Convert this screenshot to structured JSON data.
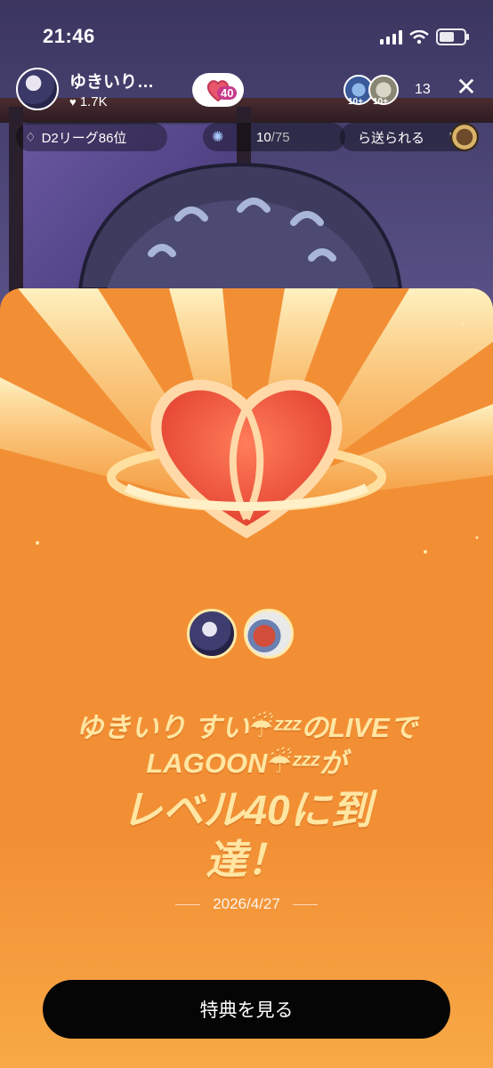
{
  "status_bar": {
    "time": "21:46"
  },
  "host": {
    "name": "ゆきいり…",
    "likes": "1.7K"
  },
  "level_chip": {
    "level": "40"
  },
  "viewers": {
    "badge1": "10+",
    "badge2": "10+",
    "count": "13"
  },
  "badges": {
    "league": "D2リーグ86位",
    "goal_current": "10",
    "goal_total": "/75",
    "ticker": "ら送られる",
    "ticker_quote": "\""
  },
  "popup": {
    "line1": "ゆきいり すい☔ᶻᶻᶻのLIVEで",
    "line2": "LAGOON☔ᶻᶻᶻが",
    "line3": "レベル40に到",
    "line4": "達！",
    "date": "2026/4/27",
    "cta": "特典を見る"
  },
  "colors": {
    "sheet": "#f28f35",
    "headline": "#ffe6a2",
    "cta_bg": "#050505"
  }
}
